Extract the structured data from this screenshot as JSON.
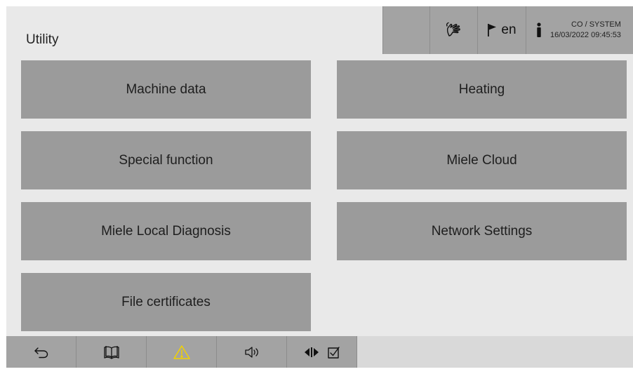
{
  "header": {
    "title": "Utility",
    "language": "en",
    "user": "CO / SYSTEM",
    "datetime": "16/03/2022 09:45:53"
  },
  "tiles": [
    {
      "label": "Machine data"
    },
    {
      "label": "Heating"
    },
    {
      "label": "Special function"
    },
    {
      "label": "Miele Cloud"
    },
    {
      "label": "Miele Local Diagnosis"
    },
    {
      "label": "Network Settings"
    },
    {
      "label": "File certificates"
    }
  ],
  "footer": {
    "icons": [
      "back-icon",
      "manual-book-icon",
      "warning-icon",
      "volume-icon",
      "display-toggle-icon",
      "checkbox-icon"
    ]
  },
  "colors": {
    "background": "#e9e9e9",
    "tile": "#9b9b9b",
    "header_cell": "#a3a3a3",
    "warning": "#f2d200"
  }
}
